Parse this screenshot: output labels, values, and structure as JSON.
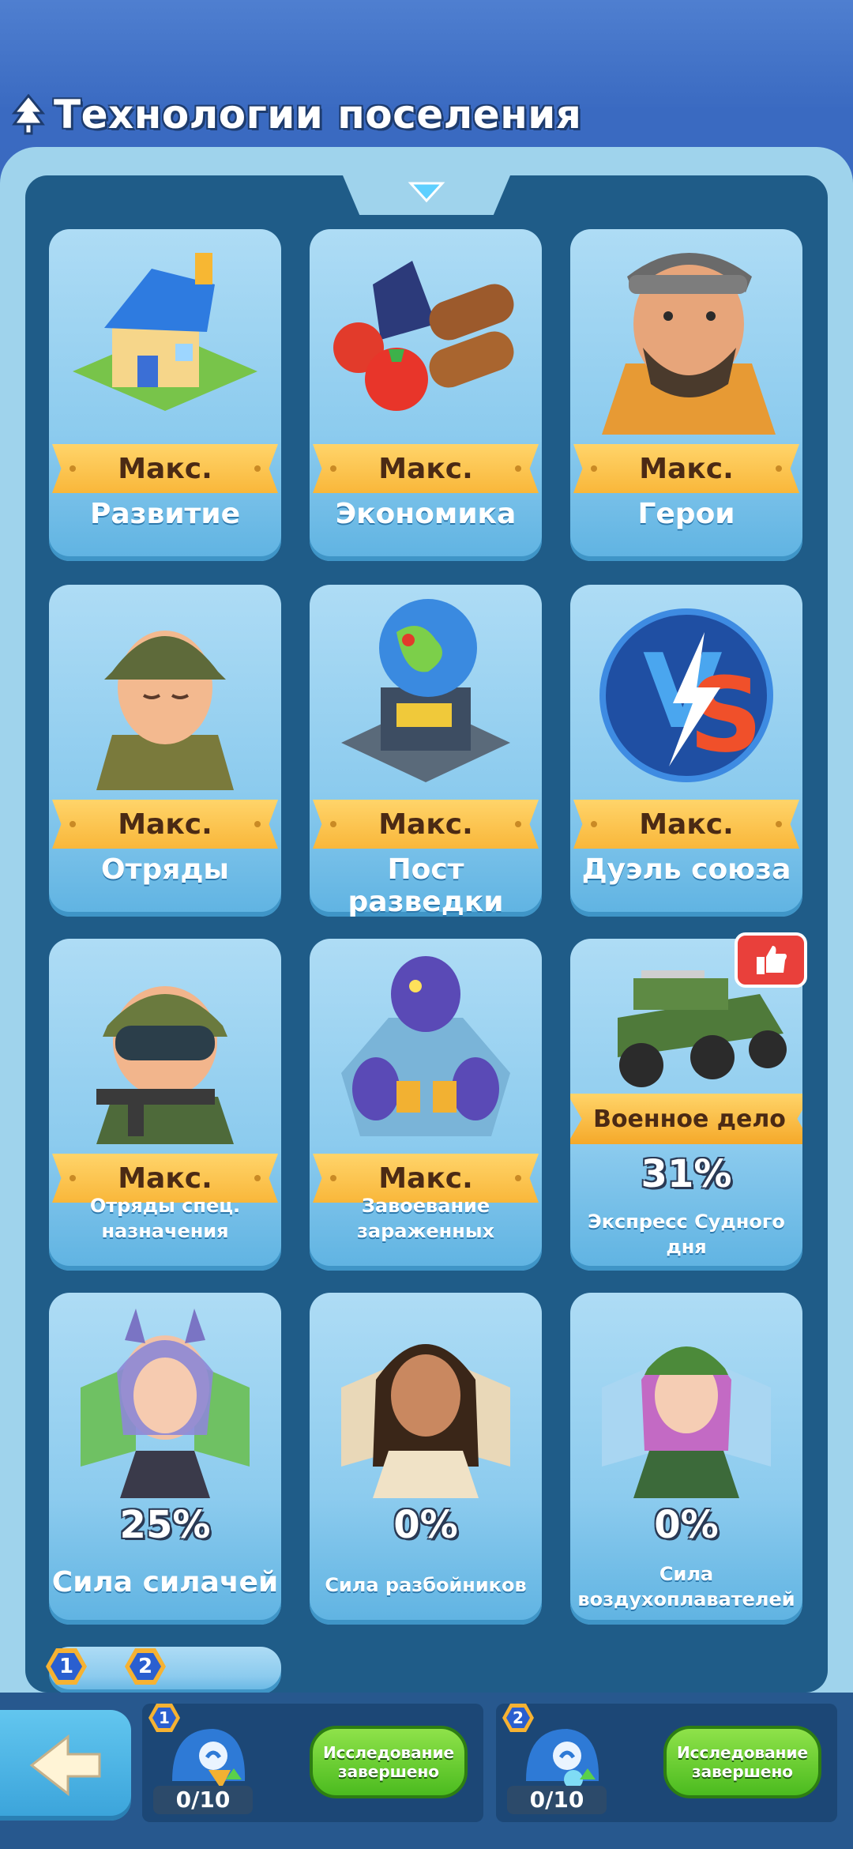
{
  "header": {
    "title": "Технологии поселения"
  },
  "cards": [
    {
      "label": "Развитие",
      "status": "Макс."
    },
    {
      "label": "Экономика",
      "status": "Макс."
    },
    {
      "label": "Герои",
      "status": "Макс."
    },
    {
      "label": "Отряды",
      "status": "Макс."
    },
    {
      "label": "Пост разведки",
      "status": "Макс."
    },
    {
      "label": "Дуэль союза",
      "status": "Макс."
    },
    {
      "label_line1": "Отряды спец.",
      "label_line2": "назначения",
      "status": "Макс."
    },
    {
      "label_line1": "Завоевание",
      "label_line2": "зараженных",
      "status": "Макс."
    },
    {
      "label_line1": "Экспресс Судного",
      "label_line2": "дня",
      "progress": "31%",
      "ribbon": "Военное дело"
    },
    {
      "label": "Сила силачей",
      "progress": "25%"
    },
    {
      "label": "Сила разбойников",
      "progress": "0%"
    },
    {
      "label_line1": "Сила",
      "label_line2": "воздухоплавателей",
      "progress": "0%"
    }
  ],
  "tabs": [
    "1",
    "2"
  ],
  "research_slots": [
    {
      "badge": "1",
      "count": "0/10",
      "button": "Исследование завершено"
    },
    {
      "badge": "2",
      "count": "0/10",
      "button": "Исследование завершено"
    }
  ],
  "colors": {
    "accent": "#f9b73a",
    "card": "#8ccbee",
    "panel": "#1f5c88",
    "green": "#4bbb1f"
  }
}
